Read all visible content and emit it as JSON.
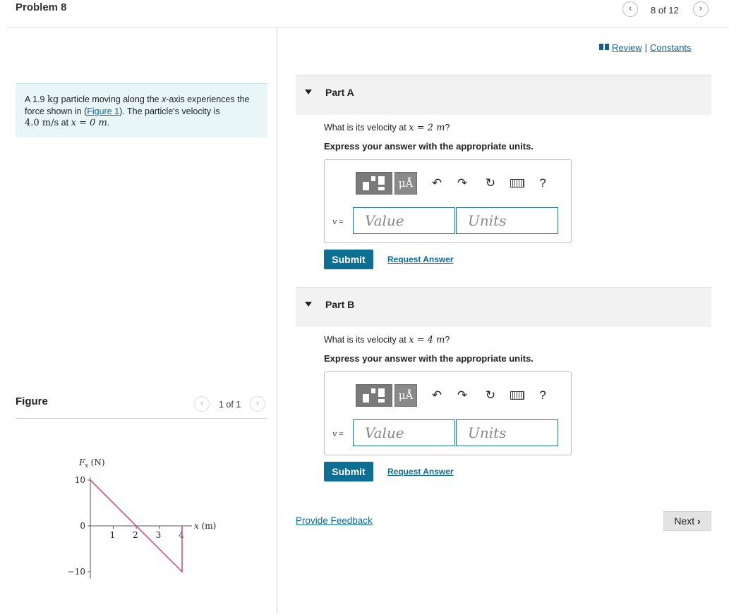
{
  "header": {
    "problem_title": "Problem 8",
    "pager_text": "8 of 12",
    "prev_glyph": "‹",
    "next_glyph": "›"
  },
  "links": {
    "review": "Review",
    "separator": "|",
    "constants": "Constants",
    "icons": [
      "book-icon"
    ]
  },
  "problem": {
    "pre_mass": "A 1.9 ",
    "mass_unit": "kg",
    "mid1": " particle moving along the ",
    "axis_var": "x",
    "mid2": "-axis experiences the force shown in (",
    "figure_link": "Figure 1",
    "mid3": "). The particle's velocity is ",
    "velocity_value": "4.0 m/s",
    "at": " at ",
    "x_eq": "x = 0 m",
    "end": "."
  },
  "figure": {
    "label": "Figure",
    "pager_text": "1 of 1"
  },
  "parts": [
    {
      "label": "Part A",
      "question_pre": "What is its velocity at ",
      "question_math": "x = 2 m",
      "question_post": "?",
      "instruction": "Express your answer with the appropriate units.",
      "var_label": "v",
      "eq": " =",
      "value_placeholder": "Value",
      "units_placeholder": "Units",
      "units_button": "μÅ",
      "help": "?",
      "submit": "Submit",
      "request_answer": "Request Answer"
    },
    {
      "label": "Part B",
      "question_pre": "What is its velocity at ",
      "question_math": "x = 4 m",
      "question_post": "?",
      "instruction": "Express your answer with the appropriate units.",
      "var_label": "v",
      "eq": " =",
      "value_placeholder": "Value",
      "units_placeholder": "Units",
      "units_button": "μÅ",
      "help": "?",
      "submit": "Submit",
      "request_answer": "Request Answer"
    }
  ],
  "toolbar_icons": [
    "templates-icon",
    "units-icon",
    "undo-icon",
    "redo-icon",
    "reset-icon",
    "keyboard-icon",
    "help-icon"
  ],
  "footer": {
    "feedback": "Provide Feedback",
    "next": "Next"
  },
  "colors": {
    "accent": "#0e6f95",
    "link": "#0a6ba0",
    "problem_bg": "#e9f6f8",
    "plot_line": "#e0245e"
  },
  "chart_data": {
    "type": "line",
    "ylabel_var": "F",
    "ylabel_sub": "x",
    "ylabel_unit": " (N)",
    "xlabel_var": "x",
    "xlabel_unit": " (m)",
    "y_ticks": [
      "10",
      "0",
      "−10"
    ],
    "y_tick_values": [
      10,
      0,
      -10
    ],
    "x_ticks": [
      "1",
      "2",
      "3",
      "4"
    ],
    "x_tick_values": [
      1,
      2,
      3,
      4
    ],
    "xlim": [
      0,
      4
    ],
    "ylim": [
      -10,
      10
    ],
    "x": [
      0,
      4,
      4
    ],
    "y": [
      10,
      -10,
      0
    ],
    "grid": false
  }
}
